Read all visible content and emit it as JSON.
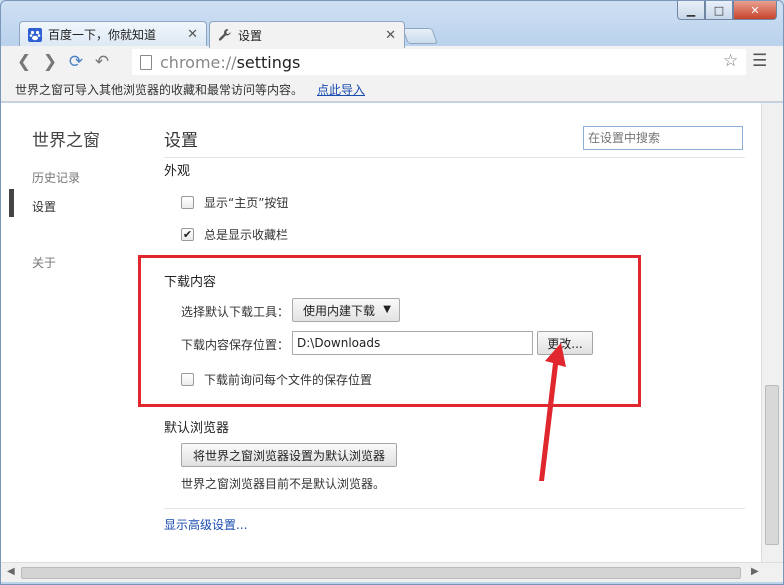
{
  "tabs": [
    {
      "title": "百度一下，你就知道",
      "icon": "paw-icon"
    },
    {
      "title": "设置",
      "icon": "wrench-icon"
    }
  ],
  "window_controls": {
    "minimize": "▁",
    "maximize": "□",
    "close": "✕"
  },
  "toolbar": {
    "url_scheme": "chrome://",
    "url_host": "settings"
  },
  "infobar": {
    "message": "世界之窗可导入其他浏览器的收藏和最常访问等内容。",
    "import_link": "点此导入"
  },
  "sidebar": {
    "title": "世界之窗",
    "items": [
      {
        "label": "历史记录"
      },
      {
        "label": "设置"
      },
      {
        "label": "关于"
      }
    ]
  },
  "main": {
    "title": "设置",
    "search_placeholder": "在设置中搜索",
    "appearance": {
      "title": "外观",
      "show_home": "显示“主页”按钮",
      "show_home_checked": false,
      "show_bookmarks": "总是显示收藏栏",
      "show_bookmarks_checked": true
    },
    "downloads": {
      "title": "下载内容",
      "tool_label": "选择默认下载工具：",
      "tool_value": "使用内建下载",
      "location_label": "下载内容保存位置：",
      "location_value": "D:\\Downloads",
      "change_button": "更改...",
      "ask_each": "下载前询问每个文件的保存位置",
      "ask_each_checked": false
    },
    "default_browser": {
      "title": "默认浏览器",
      "set_button": "将世界之窗浏览器设置为默认浏览器",
      "status": "世界之窗浏览器目前不是默认浏览器。"
    },
    "advanced_link": "显示高级设置..."
  },
  "colors": {
    "annotation": "#e0272d",
    "link": "#1a4cb0"
  }
}
